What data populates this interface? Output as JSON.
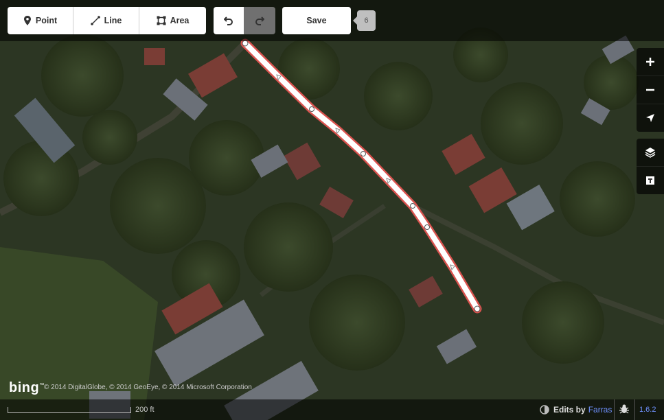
{
  "toolbar": {
    "point_label": "Point",
    "line_label": "Line",
    "area_label": "Area",
    "save_label": "Save",
    "edit_count": "6"
  },
  "footer": {
    "scale_label": "200 ft",
    "imagery_attribution": "© 2014 DigitalGlobe, © 2014 GeoEye, © 2014 Microsoft Corporation",
    "bing_logo": "bing",
    "edits_by_label": "Edits by",
    "edits_author": "Farras",
    "version": "1.6.2"
  },
  "map_controls": {
    "zoom_in_icon": "plus-icon",
    "zoom_out_icon": "minus-icon",
    "geolocate_icon": "locate-arrow-icon",
    "layers_icon": "layers-icon",
    "map_data_icon": "map-data-icon"
  },
  "colors": {
    "selected_line_halo": "#d9534f",
    "selected_line": "#ffffff",
    "link": "#7092ff"
  }
}
